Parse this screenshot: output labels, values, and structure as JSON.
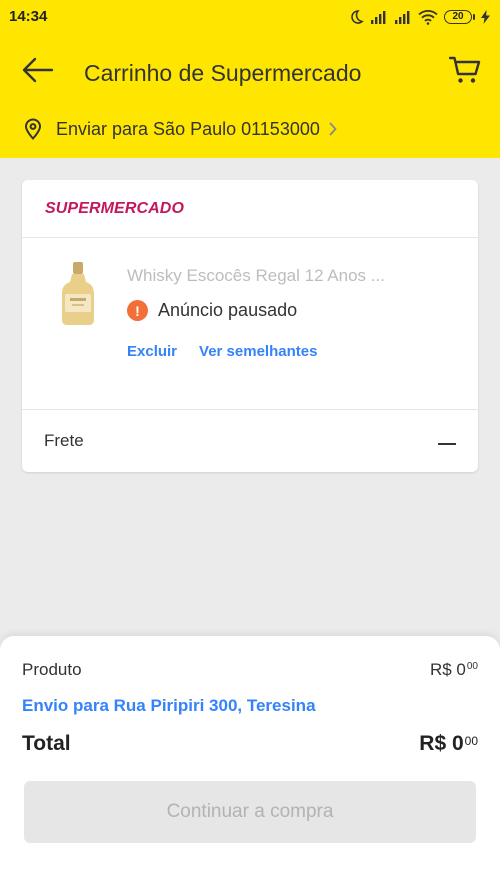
{
  "status_bar": {
    "time": "14:34",
    "battery": "20"
  },
  "header": {
    "title": "Carrinho de Supermercado",
    "address": "Enviar para São Paulo 01153000"
  },
  "cart": {
    "store_name": "SUPERMERCADO",
    "item": {
      "title": "Whisky Escocês Regal 12 Anos ...",
      "status": "Anúncio pausado",
      "actions": {
        "delete": "Excluir",
        "similar": "Ver semelhantes"
      }
    },
    "shipping_label": "Frete",
    "shipping_value": "—"
  },
  "summary": {
    "product_label": "Produto",
    "product_price_main": "R$ 0",
    "product_price_cents": "00",
    "shipping_link": "Envio para Rua Piripiri 300, Teresina",
    "total_label": "Total",
    "total_price_main": "R$ 0",
    "total_price_cents": "00",
    "continue_button": "Continuar a compra"
  },
  "colors": {
    "brand_yellow": "#ffe600",
    "link_blue": "#3483fa",
    "store_magenta": "#c4175c",
    "warning_orange": "#f36f3a",
    "disabled_gray": "#e6e6e6"
  },
  "icons": {
    "back": "arrow-left-icon",
    "cart": "shopping-cart-icon",
    "location": "location-pin-icon",
    "chevron": "chevron-right-icon",
    "warning": "exclamation-icon"
  }
}
